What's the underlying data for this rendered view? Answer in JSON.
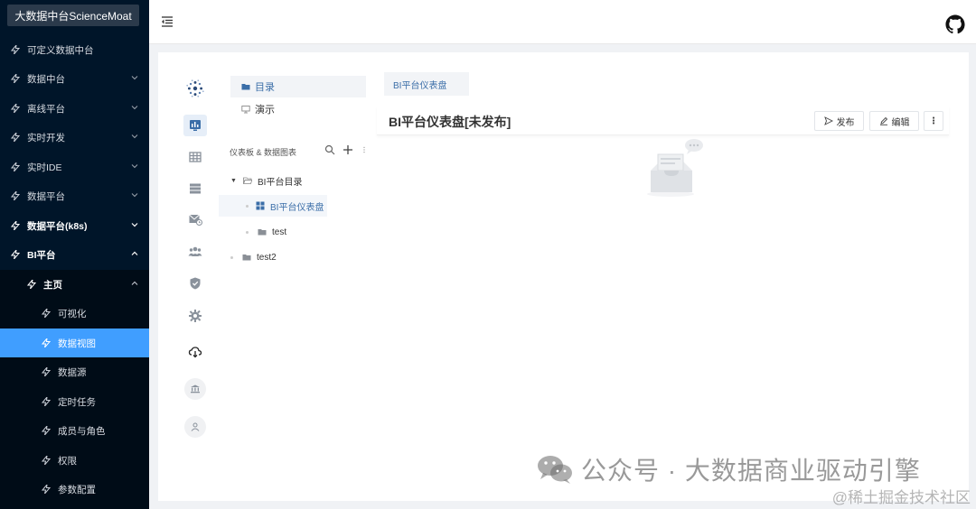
{
  "sidebar": {
    "brand": "大数据中台ScienceMoat",
    "items": [
      {
        "label": "可定义数据中台"
      },
      {
        "label": "数据中台"
      },
      {
        "label": "离线平台"
      },
      {
        "label": "实时开发"
      },
      {
        "label": "实时IDE"
      },
      {
        "label": "数据平台"
      },
      {
        "label": "数据平台(k8s)"
      },
      {
        "label": "BI平台"
      },
      {
        "label": "主页"
      },
      {
        "label": "可视化"
      },
      {
        "label": "数据视图"
      },
      {
        "label": "数据源"
      },
      {
        "label": "定时任务"
      },
      {
        "label": "成员与角色"
      },
      {
        "label": "权限"
      },
      {
        "label": "参数配置"
      }
    ]
  },
  "header": {
    "menu_toggle_icon": "menu-fold-icon",
    "github_icon": "github-icon"
  },
  "rail": {
    "icons": [
      "logo-icon",
      "dashboard-icon",
      "table-icon",
      "list-icon",
      "schedule-icon",
      "users-icon",
      "shield-icon",
      "settings-icon",
      "cloud-download-icon",
      "bank-icon",
      "user-icon"
    ]
  },
  "tree": {
    "tabs": [
      {
        "label": "目录"
      },
      {
        "label": "演示"
      }
    ],
    "header": "仪表板 & 数据图表",
    "nodes": [
      {
        "label": "BI平台目录"
      },
      {
        "label": "BI平台仪表盘"
      },
      {
        "label": "test"
      },
      {
        "label": "test2"
      }
    ]
  },
  "content": {
    "tab_label": "BI平台仪表盘",
    "title": "BI平台仪表盘[未发布]",
    "publish_label": "发布",
    "edit_label": "编辑",
    "more_label": "⋮"
  },
  "watermark": {
    "main": "公众号 · 大数据商业驱动引擎",
    "secondary": "@稀土掘金技术社区"
  },
  "colors": {
    "sidebar_bg": "#001529",
    "active_item": "#409eff",
    "accent": "#3b6ea8"
  }
}
